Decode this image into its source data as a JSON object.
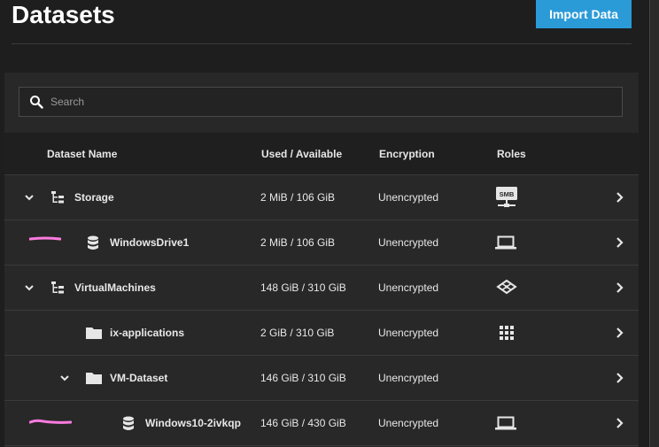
{
  "page": {
    "title": "Datasets",
    "import_label": "Import Data"
  },
  "search": {
    "placeholder": "Search"
  },
  "columns": {
    "name": "Dataset Name",
    "used": "Used / Available",
    "encryption": "Encryption",
    "roles": "Roles"
  },
  "rows": [
    {
      "name": "Storage",
      "used": "2 MiB / 106 GiB",
      "encryption": "Unencrypted",
      "type_icon": "pool-tree-icon",
      "role_icon": "smb-share-icon",
      "role_label": "SMB",
      "expanded": true
    },
    {
      "name": "WindowsDrive1",
      "used": "2 MiB / 106 GiB",
      "encryption": "Unencrypted",
      "type_icon": "zvol-database-icon",
      "role_icon": "laptop-icon"
    },
    {
      "name": "VirtualMachines",
      "used": "148 GiB / 310 GiB",
      "encryption": "Unencrypted",
      "type_icon": "pool-tree-icon",
      "role_icon": "layers-icon",
      "expanded": true
    },
    {
      "name": "ix-applications",
      "used": "2 GiB / 310 GiB",
      "encryption": "Unencrypted",
      "type_icon": "folder-icon",
      "role_icon": "apps-grid-icon"
    },
    {
      "name": "VM-Dataset",
      "used": "146 GiB / 310 GiB",
      "encryption": "Unencrypted",
      "type_icon": "folder-icon",
      "role_icon": "",
      "expanded": true
    },
    {
      "name": "Windows10-2ivkqp",
      "used": "146 GiB / 430 GiB",
      "encryption": "Unencrypted",
      "type_icon": "zvol-database-icon",
      "role_icon": "laptop-icon"
    }
  ],
  "colors": {
    "accent": "#2b9bd8",
    "annotation": "#ff7be0"
  }
}
